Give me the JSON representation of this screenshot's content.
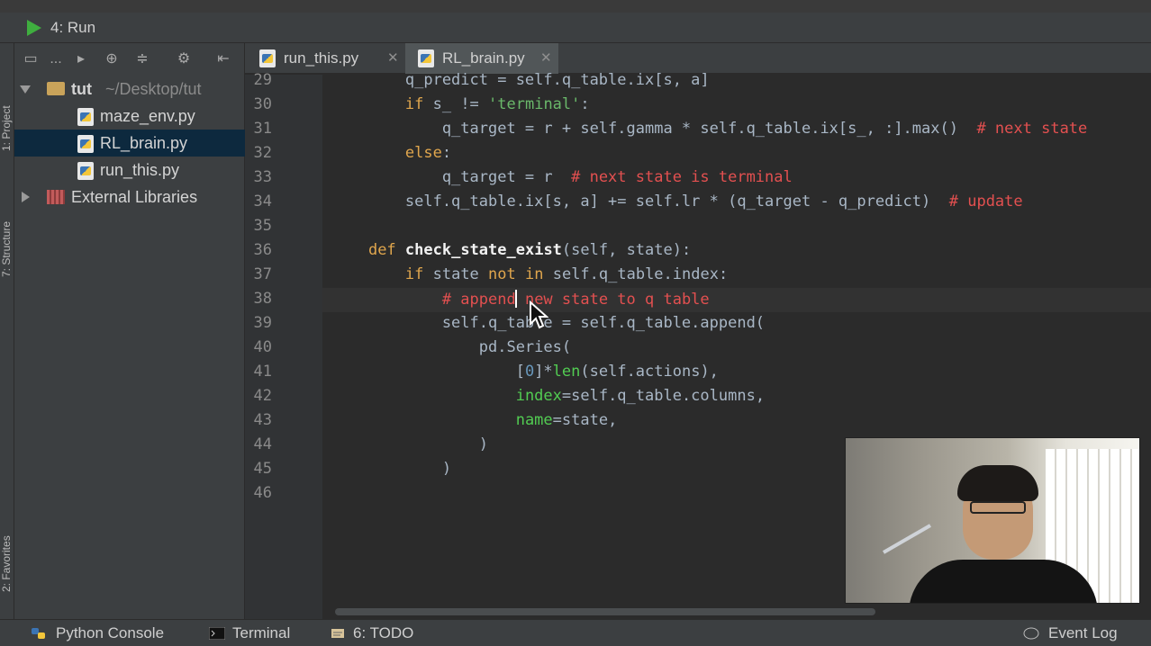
{
  "run_bar": {
    "label": "4: Run"
  },
  "left_strip": {
    "project": "1: Project",
    "structure": "7: Structure",
    "favorites": "2: Favorites"
  },
  "project_tree": {
    "root": {
      "name": "tut",
      "path": "~/Desktop/tut"
    },
    "files": [
      "maze_env.py",
      "RL_brain.py",
      "run_this.py"
    ],
    "selected_file": "RL_brain.py",
    "external": "External Libraries",
    "toolbar_overflow": "..."
  },
  "tabs": [
    {
      "label": "run_this.py",
      "active": false
    },
    {
      "label": "RL_brain.py",
      "active": true
    }
  ],
  "tab_close_glyph": "✕",
  "code_lines": [
    {
      "n": "29",
      "text": "        q_predict = self.q_table.ix[s, a]"
    },
    {
      "n": "30",
      "text": "        if s_ != 'terminal':"
    },
    {
      "n": "31",
      "text": "            q_target = r + self.gamma * self.q_table.ix[s_, :].max()  # next state"
    },
    {
      "n": "32",
      "text": "        else:"
    },
    {
      "n": "33",
      "text": "            q_target = r  # next state is terminal"
    },
    {
      "n": "34",
      "text": "        self.q_table.ix[s, a] += self.lr * (q_target - q_predict)  # update"
    },
    {
      "n": "35",
      "text": ""
    },
    {
      "n": "36",
      "text": "    def check_state_exist(self, state):"
    },
    {
      "n": "37",
      "text": "        if state not in self.q_table.index:"
    },
    {
      "n": "38",
      "text": "            # append new state to q table"
    },
    {
      "n": "39",
      "text": "            self.q_table = self.q_table.append("
    },
    {
      "n": "40",
      "text": "                pd.Series("
    },
    {
      "n": "41",
      "text": "                    [0]*len(self.actions),"
    },
    {
      "n": "42",
      "text": "                    index=self.q_table.columns,"
    },
    {
      "n": "43",
      "text": "                    name=state,"
    },
    {
      "n": "44",
      "text": "                )"
    },
    {
      "n": "45",
      "text": "            )"
    },
    {
      "n": "46",
      "text": ""
    }
  ],
  "bottom_bar": {
    "python_console": "Python Console",
    "terminal": "Terminal",
    "todo": "6: TODO",
    "event_log": "Event Log"
  },
  "colors": {
    "keyword": "#e0a64d",
    "string": "#6ab86a",
    "comment": "#e35050",
    "builtin": "#52cc52",
    "background": "#2b2b2b",
    "run_icon": "#3fae3f"
  }
}
